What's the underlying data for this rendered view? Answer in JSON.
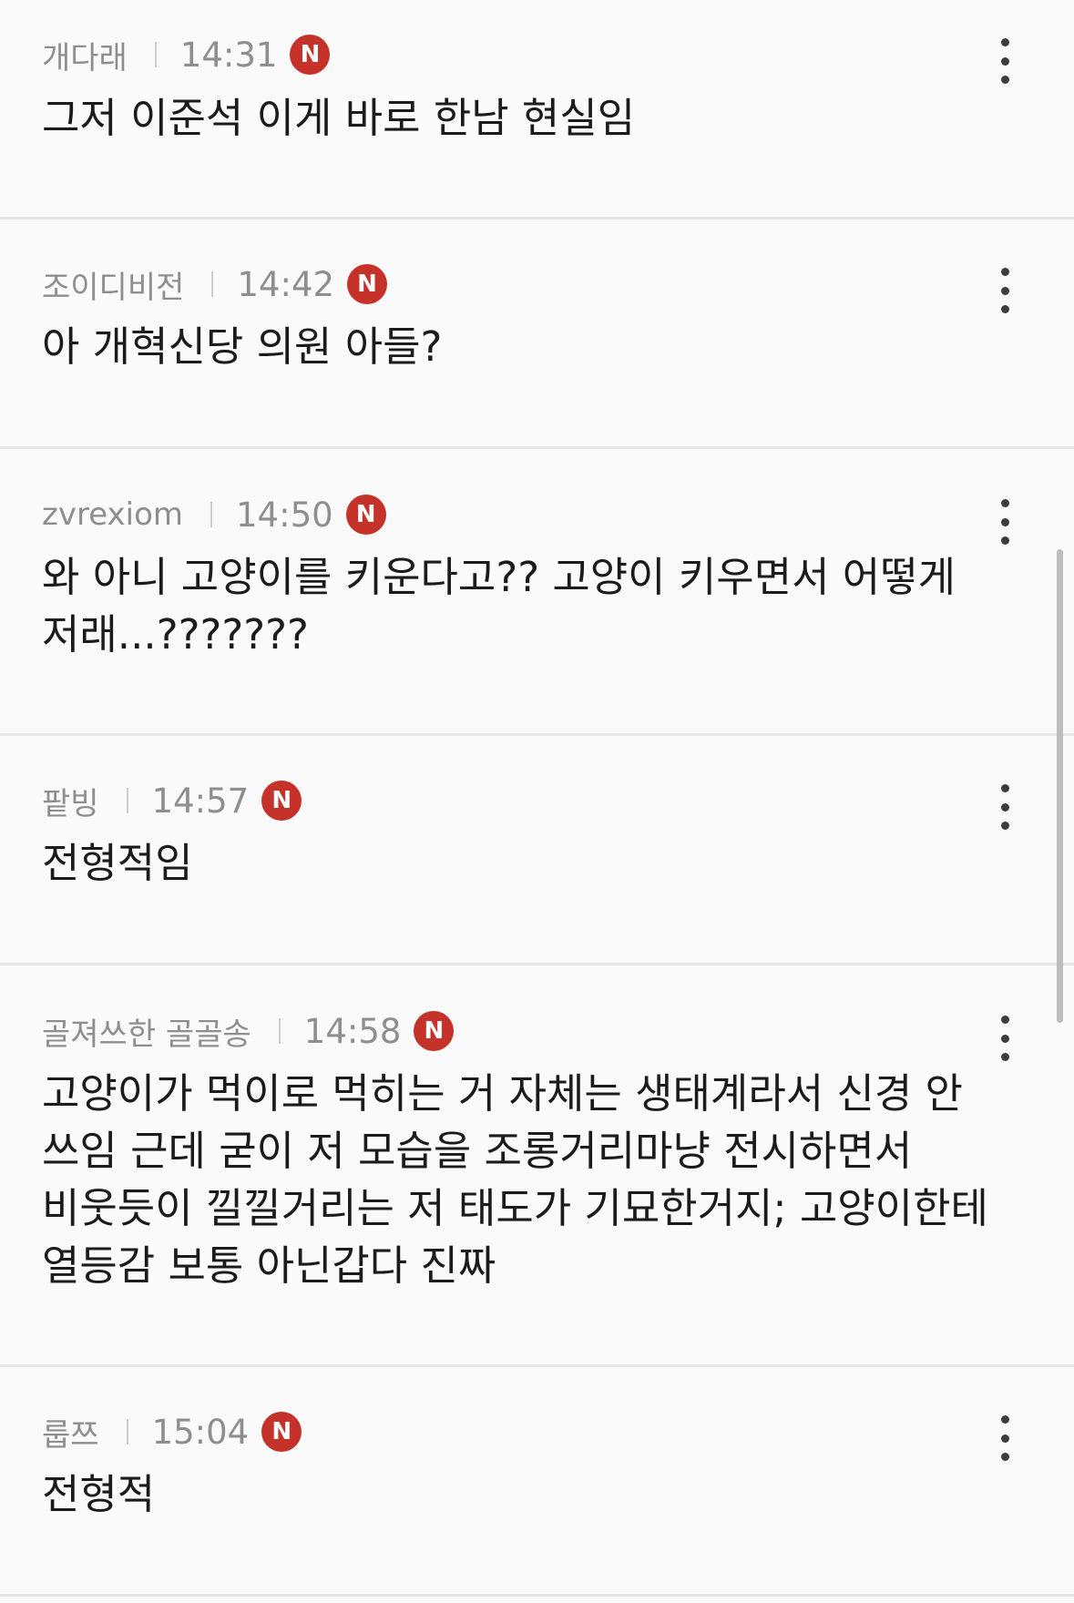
{
  "badge_label": "N",
  "colors": {
    "badge": "#c4322a",
    "meta_text": "#8e8e8e",
    "body_text": "#1b1b1b",
    "divider": "#e6e6e6"
  },
  "icons": {
    "more": "more-vertical-icon",
    "badge": "new-badge-icon"
  },
  "comments": [
    {
      "author": "개다래",
      "time": "14:31",
      "text": "그저 이준석 이게 바로 한남 현실임"
    },
    {
      "author": "조이디비전",
      "time": "14:42",
      "text": "아 개혁신당 의원 아들?"
    },
    {
      "author": "zvrexiom",
      "time": "14:50",
      "text": "와 아니 고양이를 키운다고?? 고양이 키우면서 어떻게 저래...???????"
    },
    {
      "author": "팥빙",
      "time": "14:57",
      "text": "전형적임"
    },
    {
      "author": "골져쓰한 골골송",
      "time": "14:58",
      "text": "고양이가 먹이로 먹히는 거 자체는 생태계라서 신경 안 쓰임 근데 굳이 저 모습을 조롱거리마냥 전시하면서 비웃듯이 낄낄거리는 저 태도가 기묘한거지; 고양이한테 열등감 보통 아닌갑다 진짜"
    },
    {
      "author": "룹쯔",
      "time": "15:04",
      "text": "전형적"
    }
  ]
}
